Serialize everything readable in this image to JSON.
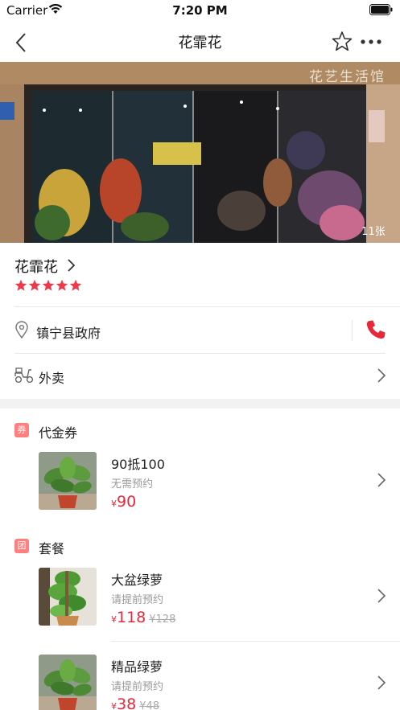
{
  "status": {
    "carrier": "Carrier",
    "time": "7:20 PM"
  },
  "nav": {
    "title": "花霏花"
  },
  "hero": {
    "sign": "花艺生活馆",
    "photo_count": "11张"
  },
  "shop": {
    "name": "花霏花",
    "rating": 5,
    "max_rating": 5
  },
  "address": {
    "text": "镇宁县政府"
  },
  "delivery": {
    "label": "外卖"
  },
  "voucher_section": {
    "badge": "券",
    "title": "代金券",
    "items": [
      {
        "title": "90抵100",
        "subtitle": "无需预约",
        "currency": "¥",
        "price": "90",
        "original": ""
      }
    ]
  },
  "package_section": {
    "badge": "团",
    "title": "套餐",
    "items": [
      {
        "title": "大盆绿萝",
        "subtitle": "请提前预约",
        "currency": "¥",
        "price": "118",
        "original": "¥128"
      },
      {
        "title": "精品绿萝",
        "subtitle": "请提前预约",
        "currency": "¥",
        "price": "38",
        "original": "¥48"
      }
    ]
  },
  "colors": {
    "accent": "#e8283a",
    "star": "#f0384a",
    "badge": "#ff7f7f"
  }
}
